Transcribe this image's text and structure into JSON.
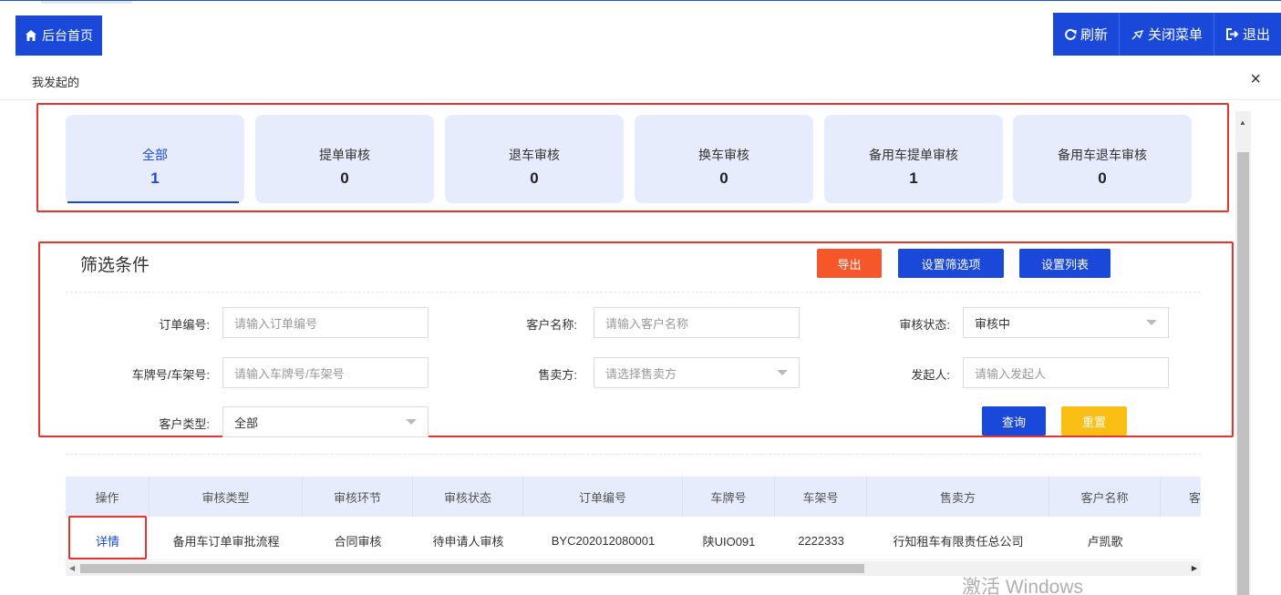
{
  "topbar": {
    "home_label": "后台首页",
    "refresh_label": "刷新",
    "close_menu_label": "关闭菜单",
    "logout_label": "退出"
  },
  "page": {
    "title": "我发起的",
    "close_symbol": "×"
  },
  "tabs": [
    {
      "label": "全部",
      "count": "1",
      "active": true
    },
    {
      "label": "提单审核",
      "count": "0"
    },
    {
      "label": "退车审核",
      "count": "0"
    },
    {
      "label": "换车审核",
      "count": "0"
    },
    {
      "label": "备用车提单审核",
      "count": "1"
    },
    {
      "label": "备用车退车审核",
      "count": "0"
    }
  ],
  "filter": {
    "title": "筛选条件",
    "export_label": "导出",
    "set_filter_label": "设置筛选项",
    "set_columns_label": "设置列表",
    "order_no_label": "订单编号:",
    "order_no_placeholder": "请输入订单编号",
    "customer_name_label": "客户名称:",
    "customer_name_placeholder": "请输入客户名称",
    "status_label": "审核状态:",
    "status_value": "审核中",
    "plate_label": "车牌号/车架号:",
    "plate_placeholder": "请输入车牌号/车架号",
    "seller_label": "售卖方:",
    "seller_placeholder": "请选择售卖方",
    "initiator_label": "发起人:",
    "initiator_placeholder": "请输入发起人",
    "customer_type_label": "客户类型:",
    "customer_type_value": "全部",
    "query_label": "查询",
    "reset_label": "重置"
  },
  "table": {
    "headers": [
      "操作",
      "审核类型",
      "审核环节",
      "审核状态",
      "订单编号",
      "车牌号",
      "车架号",
      "售卖方",
      "客户名称",
      "客"
    ],
    "rows": [
      [
        "详情",
        "备用车订单审批流程",
        "合同审核",
        "待申请人审核",
        "BYC202012080001",
        "陕UIO091",
        "2222333",
        "行知租车有限责任总公司",
        "卢凯歌",
        ""
      ]
    ]
  },
  "watermark": "激活 Windows",
  "colors": {
    "primary": "#1a48d8",
    "export": "#f5572a",
    "reset": "#fbbe14",
    "tab_bg": "#e6ecfb",
    "highlight_border": "#e8332d"
  }
}
